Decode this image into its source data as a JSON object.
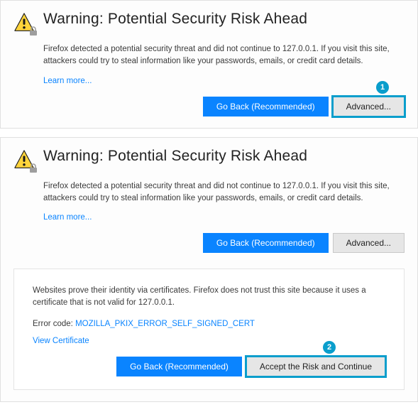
{
  "panel1": {
    "title": "Warning: Potential Security Risk Ahead",
    "desc": "Firefox detected a potential security threat and did not continue to 127.0.0.1. If you visit this site, attackers could try to steal information like your passwords, emails, or credit card details.",
    "learn_more": "Learn more...",
    "go_back": "Go Back (Recommended)",
    "advanced": "Advanced...",
    "callout": "1"
  },
  "panel2": {
    "title": "Warning: Potential Security Risk Ahead",
    "desc": "Firefox detected a potential security threat and did not continue to 127.0.0.1. If you visit this site, attackers could try to steal information like your passwords, emails, or credit card details.",
    "learn_more": "Learn more...",
    "go_back": "Go Back (Recommended)",
    "advanced": "Advanced...",
    "details_desc": "Websites prove their identity via certificates. Firefox does not trust this site because it uses a certificate that is not valid for 127.0.0.1.",
    "error_label": "Error code: ",
    "error_code": "MOZILLA_PKIX_ERROR_SELF_SIGNED_CERT",
    "view_cert": "View Certificate",
    "go_back2": "Go Back (Recommended)",
    "accept": "Accept the Risk and Continue",
    "callout": "2"
  }
}
